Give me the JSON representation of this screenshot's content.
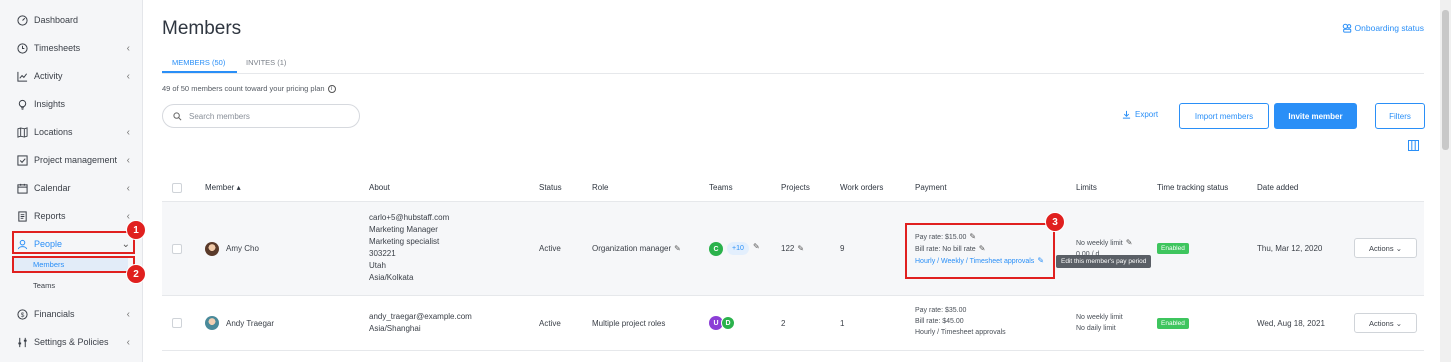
{
  "sidebar": {
    "items": [
      {
        "label": "Dashboard",
        "icon": "dashboard-icon"
      },
      {
        "label": "Timesheets",
        "icon": "clock-icon"
      },
      {
        "label": "Activity",
        "icon": "chart-icon"
      },
      {
        "label": "Insights",
        "icon": "bulb-icon"
      },
      {
        "label": "Locations",
        "icon": "map-icon"
      },
      {
        "label": "Project management",
        "icon": "checkbox-icon"
      },
      {
        "label": "Calendar",
        "icon": "calendar-icon"
      },
      {
        "label": "Reports",
        "icon": "report-icon"
      },
      {
        "label": "People",
        "icon": "person-icon"
      },
      {
        "label": "Financials",
        "icon": "dollar-icon"
      },
      {
        "label": "Settings & Policies",
        "icon": "sliders-icon"
      }
    ],
    "sub_members": "Members",
    "sub_teams": "Teams"
  },
  "annotations": [
    "1",
    "2",
    "3"
  ],
  "header": {
    "title": "Members",
    "onboarding": "Onboarding status"
  },
  "tabs": {
    "members": "MEMBERS (50)",
    "invites": "INVITES (1)"
  },
  "count_note": "49 of 50 members count toward your pricing plan",
  "search": {
    "placeholder": "Search members"
  },
  "toolbar": {
    "export": "Export",
    "import": "Import members",
    "invite": "Invite member",
    "filters": "Filters"
  },
  "table": {
    "headers": {
      "member": "Member",
      "about": "About",
      "status": "Status",
      "role": "Role",
      "teams": "Teams",
      "projects": "Projects",
      "work_orders": "Work orders",
      "payment": "Payment",
      "limits": "Limits",
      "time_tracking": "Time tracking status",
      "date_added": "Date added"
    },
    "rows": [
      {
        "name": "Amy Cho",
        "about": [
          "carlo+5@hubstaff.com",
          "Marketing Manager",
          "Marketing specialist",
          "303221",
          "Utah",
          "Asia/Kolkata"
        ],
        "status": "Active",
        "role": "Organization manager",
        "team_initial": "C",
        "team_more": "+10",
        "projects": "122",
        "work_orders": "9",
        "pay_rate": "Pay rate: $15.00",
        "bill_rate": "Bill rate: No bill rate",
        "pay_period": "Hourly / Weekly / Timesheet approvals",
        "limit_weekly": "No weekly limit",
        "limit_daily": "0.00 / d",
        "tracking": "Enabled",
        "date": "Thu, Mar 12, 2020",
        "actions": "Actions"
      },
      {
        "name": "Andy Traegar",
        "about": [
          "andy_traegar@example.com",
          "Asia/Shanghai"
        ],
        "status": "Active",
        "role": "Multiple project roles",
        "team_initials": [
          "U",
          "D"
        ],
        "projects": "2",
        "work_orders": "1",
        "pay_rate": "Pay rate: $35.00",
        "bill_rate": "Bill rate: $45.00",
        "pay_period": "Hourly / Timesheet approvals",
        "limit_weekly": "No weekly limit",
        "limit_daily": "No daily limit",
        "tracking": "Enabled",
        "date": "Wed, Aug 18, 2021",
        "actions": "Actions"
      }
    ]
  },
  "tooltip": "Edit this member's pay period",
  "colors": {
    "accent": "#2a8ff7",
    "highlight": "#e0201f",
    "enabled": "#3ec55e",
    "team_c": "#2bb24c",
    "team_u": "#8c3fd6",
    "team_d": "#2bb24c"
  }
}
